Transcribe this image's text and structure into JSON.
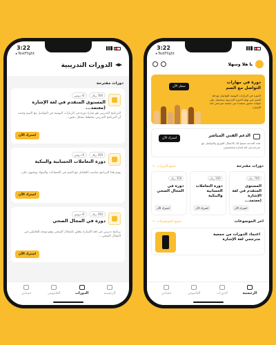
{
  "status": {
    "time": "3:22",
    "testflight": "◂ TestFlight"
  },
  "left": {
    "title": "الدورات التدريبية",
    "section": "دورات مقترحة",
    "courses": [
      {
        "price": "700 ريال",
        "duration": "8 دروس",
        "title": "المستوى المتقدم في لغة الإشارة (معتمد...",
        "desc": "البرنامج التدريبي هو عبارة دورة في الزيارات اليومية في التواصل مع الصم وحيث أن البرنامج التدريبي مخطط بشكل دقيق...",
        "cta": "اشترك الآن"
      },
      {
        "price": "350 ريال",
        "duration": "8 دروس",
        "title": "دورة التعاملات الحسابية والبنكية",
        "desc": "يهتم هذا البرنامج مناسب للتعامل مع الصم في الحسابات والبنوك ويحتوي على:",
        "cta": "اشترك الآن"
      },
      {
        "price": "350 ريال",
        "duration": "8 دروس",
        "title": "دورة في المجال الصحي",
        "desc": "برنامج تدريبي في لغة الإشارة يتعلق بالمجال الصحي وهو موجه للعاملين في المجال الصحي...",
        "cta": "اشترك الآن"
      }
    ],
    "nav": [
      {
        "label": "الرئيسية",
        "active": false
      },
      {
        "label": "الدورات",
        "active": true
      },
      {
        "label": "القاموس",
        "active": false
      },
      {
        "label": "حسابي",
        "active": false
      }
    ]
  },
  "right": {
    "greeting": "يا هلا وسهلا",
    "hero": {
      "title": "دورة في مهارات التواصل مع الصم",
      "desc": "الدورة في الزيارات اليومية للتواصل مع فئة الصم، في نهاية الدورة التدريبية سنحصل على شهادة حضور معتمدة من جمعية مترجمي لغة الإشارة",
      "cta": "سجل الآن"
    },
    "support": {
      "title": "الدعم الفني المباشر",
      "desc": "هذه الخدمة تسمح لك بالاتصال الفوري والتواصل مع مترجم في لغة إشارة متخصصين",
      "cta": "اشترك الآن"
    },
    "suggested": {
      "title": "دورات مقترحة",
      "link": "جميع الدورات ←",
      "cards": [
        {
          "price": "700 ريال",
          "title": "المستوى المتقدم في لغة الإشارة (معتمد...",
          "cta": "اشترك الآن"
        },
        {
          "price": "350 ريال",
          "title": "دورة التعاملات الحسابية والبنكية",
          "cta": "اشترك الآن"
        },
        {
          "price": "350 ريال",
          "title": "دورة في المجال الصحي",
          "cta": "اشترك الآن"
        }
      ]
    },
    "topics": {
      "title": "اخر الموضوعات",
      "link": "جميع الموضوعات ←",
      "item": "اعتماد الدورات من جمعية مترجمي لغة الإشارة"
    },
    "nav": [
      {
        "label": "الرئيسية",
        "active": true
      },
      {
        "label": "الدورات",
        "active": false
      },
      {
        "label": "القاموس",
        "active": false
      },
      {
        "label": "حسابي",
        "active": false
      }
    ]
  }
}
